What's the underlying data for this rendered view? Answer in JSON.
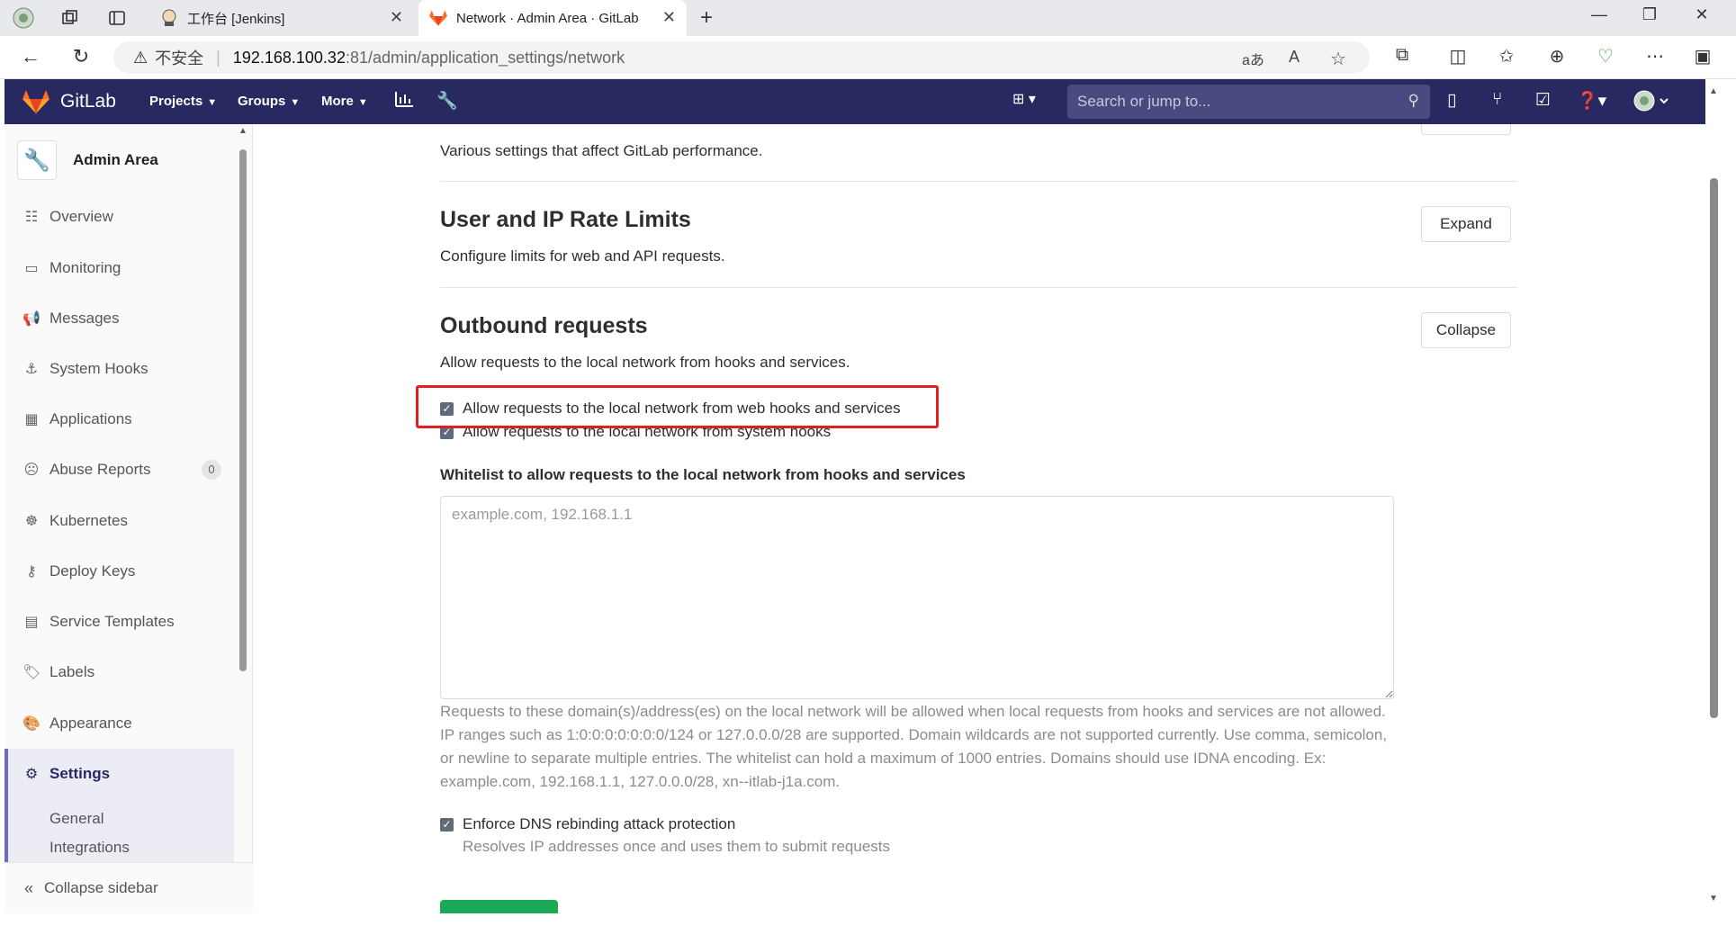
{
  "browser": {
    "tabs": [
      {
        "title": "工作台 [Jenkins]",
        "active": false
      },
      {
        "title": "Network · Admin Area · GitLab",
        "active": true
      }
    ],
    "url": {
      "security_label": "不安全",
      "host": "192.168.100.32",
      "rest": ":81/admin/application_settings/network"
    },
    "reader_glyph": "aあ",
    "readaloud_glyph": "A",
    "icons": [
      "refresh-icon",
      "back-icon",
      "favorite-star-icon",
      "extensions-icon",
      "split-screen-icon",
      "favorites-icon",
      "collections-icon",
      "performance-icon",
      "more-icon",
      "sidebar-icon"
    ]
  },
  "gitlab_nav": {
    "brand": "GitLab",
    "menus": [
      {
        "label": "Projects"
      },
      {
        "label": "Groups"
      },
      {
        "label": "More"
      }
    ],
    "search_placeholder": "Search or jump to...",
    "brand_color": "#292961"
  },
  "sidebar": {
    "title": "Admin Area",
    "items": [
      {
        "label": "Overview",
        "icon": "overview-icon"
      },
      {
        "label": "Monitoring",
        "icon": "monitoring-icon"
      },
      {
        "label": "Messages",
        "icon": "messages-icon"
      },
      {
        "label": "System Hooks",
        "icon": "hook-icon"
      },
      {
        "label": "Applications",
        "icon": "applications-icon"
      },
      {
        "label": "Abuse Reports",
        "icon": "abuse-icon",
        "badge": "0"
      },
      {
        "label": "Kubernetes",
        "icon": "kubernetes-icon"
      },
      {
        "label": "Deploy Keys",
        "icon": "key-icon"
      },
      {
        "label": "Service Templates",
        "icon": "template-icon"
      },
      {
        "label": "Labels",
        "icon": "label-icon"
      },
      {
        "label": "Appearance",
        "icon": "appearance-icon"
      },
      {
        "label": "Settings",
        "icon": "settings-icon",
        "active": true
      }
    ],
    "sub_items": [
      {
        "label": "General"
      },
      {
        "label": "Integrations"
      }
    ],
    "collapse_label": "Collapse sidebar"
  },
  "main": {
    "performance_desc": "Various settings that affect GitLab performance.",
    "rate_limits": {
      "title": "User and IP Rate Limits",
      "desc": "Configure limits for web and API requests.",
      "button": "Expand"
    },
    "outbound": {
      "title": "Outbound requests",
      "desc": "Allow requests to the local network from hooks and services.",
      "button": "Collapse",
      "check_web_hooks": "Allow requests to the local network from web hooks and services",
      "check_system_hooks": "Allow requests to the local network from system hooks",
      "whitelist_label": "Whitelist to allow requests to the local network from hooks and services",
      "whitelist_placeholder": "example.com, 192.168.1.1",
      "whitelist_help": "Requests to these domain(s)/address(es) on the local network will be allowed when local requests from hooks and services are not allowed. IP ranges such as 1:0:0:0:0:0:0:0/124 or 127.0.0.0/28 are supported. Domain wildcards are not supported currently. Use comma, semicolon, or newline to separate multiple entries. The whitelist can hold a maximum of 1000 entries. Domains should use IDNA encoding. Ex: example.com, 192.168.1.1, 127.0.0.0/28, xn--itlab-j1a.com.",
      "check_dns": "Enforce DNS rebinding attack protection",
      "dns_help": "Resolves IP addresses once and uses them to submit requests"
    },
    "highlight_color": "#e02020"
  }
}
